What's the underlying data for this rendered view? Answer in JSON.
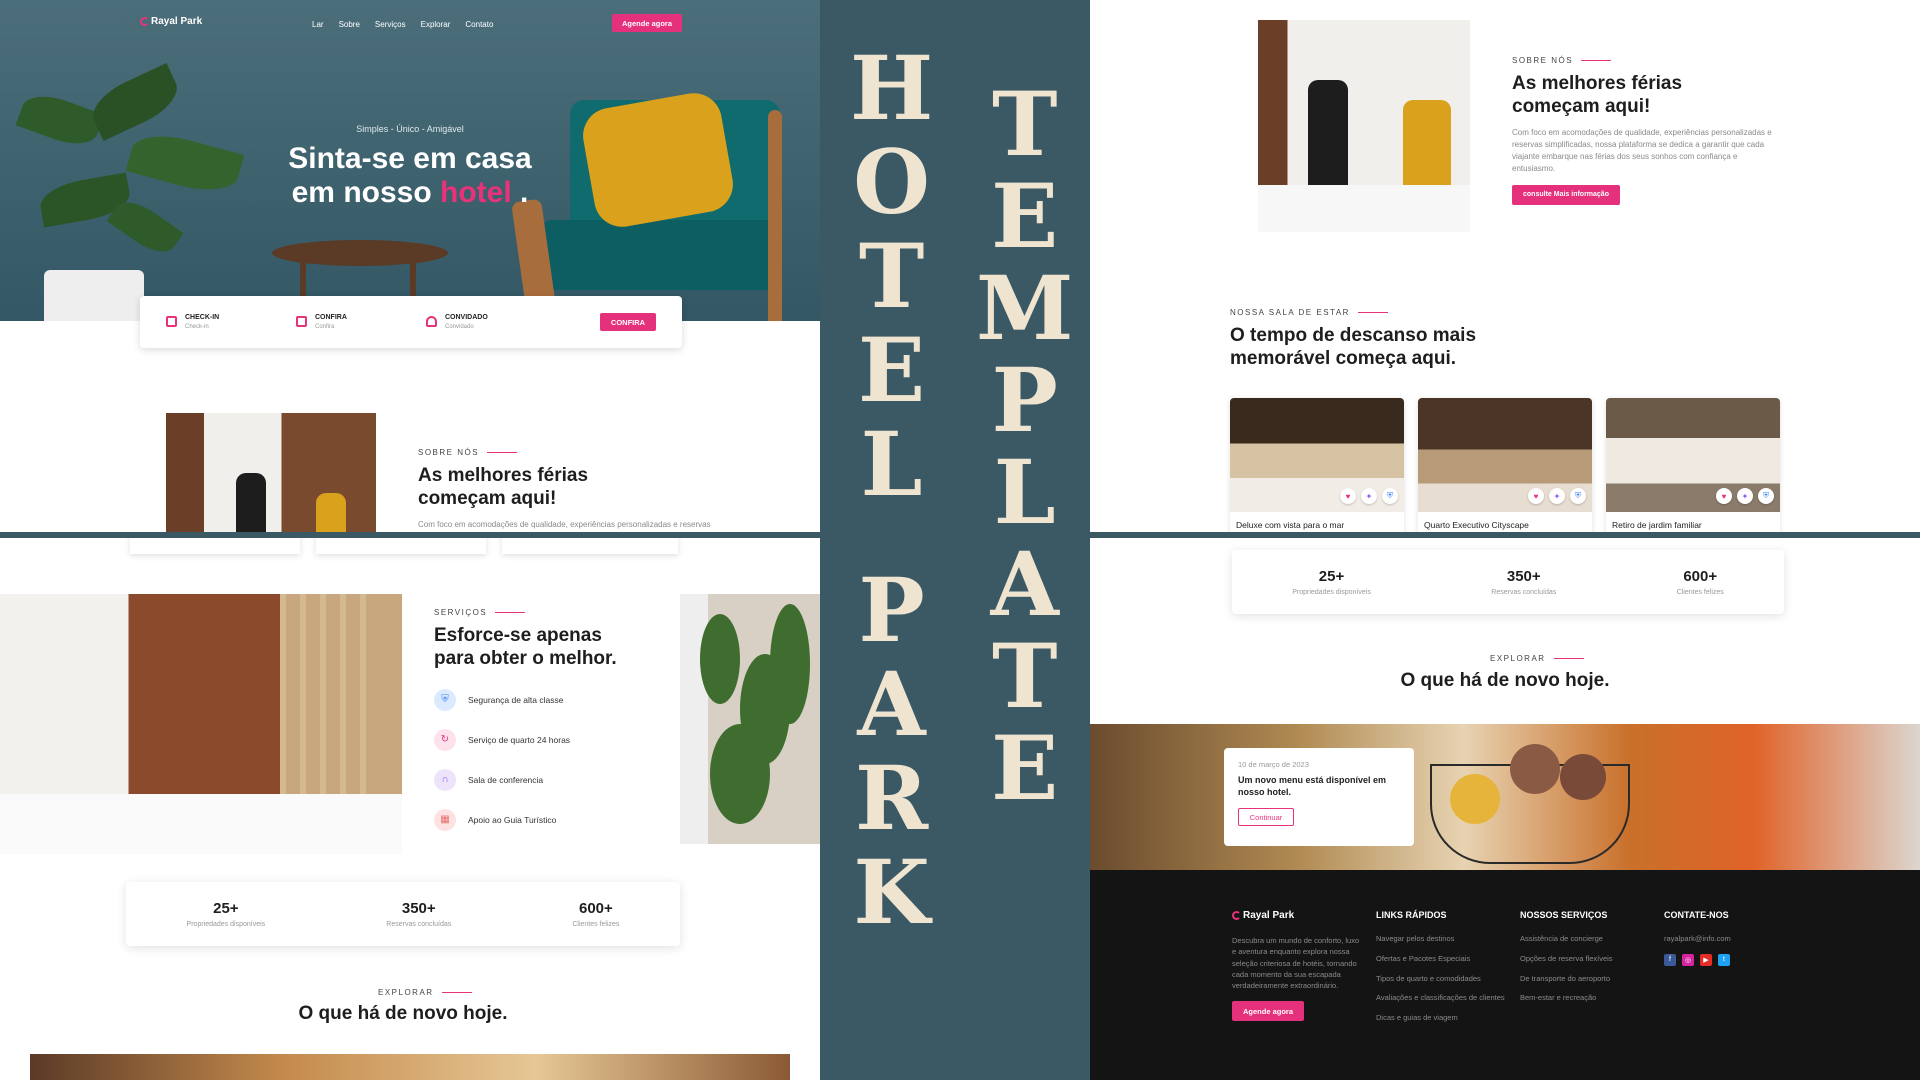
{
  "hero": {
    "brand": "Rayal Park",
    "nav": [
      "Lar",
      "Sobre",
      "Serviços",
      "Explorar",
      "Contato"
    ],
    "cta": "Agende agora",
    "tagline": "Simples - Único - Amigável",
    "title_line1": "Sinta-se em casa",
    "title_line2_prefix": "em nosso",
    "title_highlight": "hotel",
    "title_suffix": "."
  },
  "booking": {
    "fields": [
      {
        "label": "CHECK-IN",
        "sub": "Check-in"
      },
      {
        "label": "CONFIRA",
        "sub": "Confira"
      },
      {
        "label": "CONVIDADO",
        "sub": "Convidado"
      }
    ],
    "button": "CONFIRA"
  },
  "about": {
    "eyebrow": "SOBRE NÓS",
    "title_line1": "As melhores férias",
    "title_line2": "começam aqui!",
    "text": "Com foco em acomodações de qualidade, experiências personalizadas e reservas simplificadas, nossa plataforma se dedica a garantir que cada viajante embarque nas férias dos seus sonhos com confiança e entusiasmo.",
    "button": "consulte Mais informação"
  },
  "services": {
    "eyebrow": "SERVIÇOS",
    "title_line1": "Esforce-se apenas",
    "title_line2": "para obter o melhor.",
    "items": [
      {
        "label": "Segurança de alta classe",
        "icon": "shield-icon",
        "color": "#dbeafe",
        "fg": "#3b82f6"
      },
      {
        "label": "Serviço de quarto 24 horas",
        "icon": "refresh-icon",
        "color": "#fde2ee",
        "fg": "#e8327a"
      },
      {
        "label": "Sala de conferencia",
        "icon": "headset-icon",
        "color": "#ede4fb",
        "fg": "#8b5cf6"
      },
      {
        "label": "Apoio ao Guia Turístico",
        "icon": "map-icon",
        "color": "#fde2e2",
        "fg": "#e86a6a"
      }
    ]
  },
  "stats": [
    {
      "num": "25+",
      "label": "Propriedades disponíveis"
    },
    {
      "num": "350+",
      "label": "Reservas concluídas"
    },
    {
      "num": "600+",
      "label": "Clientes felizes"
    }
  ],
  "explore": {
    "eyebrow": "EXPLORAR",
    "title": "O que há de novo hoje."
  },
  "lounge": {
    "eyebrow": "NOSSA SALA DE ESTAR",
    "title_line1": "O tempo de descanso mais",
    "title_line2": "memorável começa aqui.",
    "rooms": [
      {
        "name": "Deluxe com vista para o mar"
      },
      {
        "name": "Quarto Executivo Cityscape"
      },
      {
        "name": "Retiro de jardim familiar"
      }
    ]
  },
  "news": {
    "date": "10 de março de 2023",
    "title": "Um novo menu está disponível em nosso hotel.",
    "button": "Continuar"
  },
  "footer": {
    "brand": "Rayal Park",
    "text": "Descubra um mundo de conforto, luxo e aventura enquanto explora nossa seleção criteriosa de hotéis, tornando cada momento da sua escapada verdadeiramente extraordinário.",
    "cta": "Agende agora",
    "quick_title": "LINKS RÁPIDOS",
    "quick_links": [
      "Navegar pelos destinos",
      "Ofertas e Pacotes Especiais",
      "Tipos de quarto e comodidades",
      "Avaliações e classificações de clientes",
      "Dicas e guias de viagem"
    ],
    "services_title": "NOSSOS SERVIÇOS",
    "services_links": [
      "Assistência de concierge",
      "Opções de reserva flexíveis",
      "De transporte do aeroporto",
      "Bem-estar e recreação"
    ],
    "contact_title": "CONTATE-NOS",
    "email": "rayalpark@info.com"
  },
  "poster": {
    "word1": "HOTEL",
    "word2": "PARK",
    "word3": "TEMPLATE"
  },
  "colors": {
    "accent": "#e8327a",
    "background": "#3b5965",
    "title": "#efe4d0"
  }
}
